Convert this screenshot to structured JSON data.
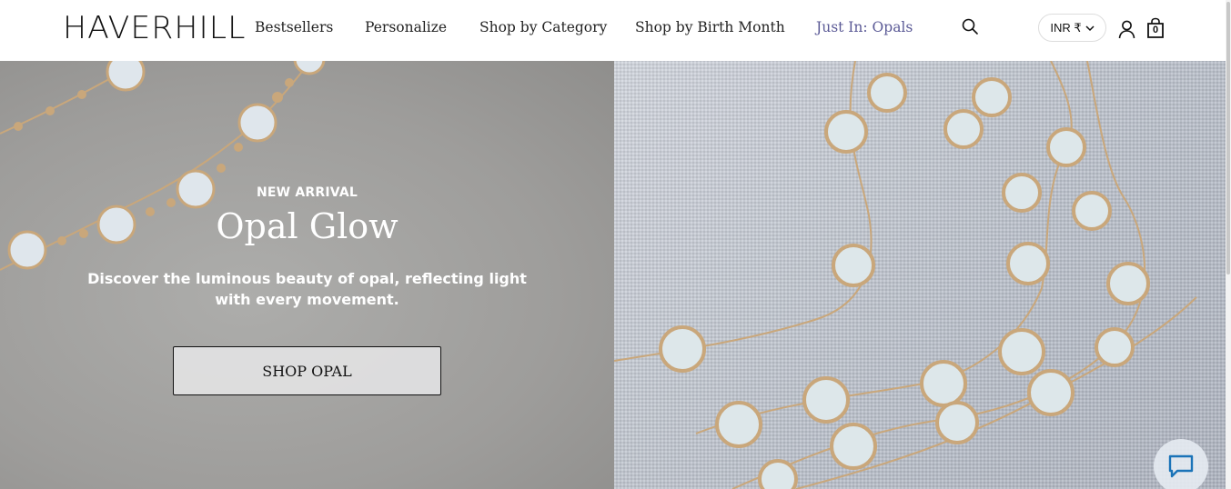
{
  "brand": {
    "logo_text": "HAVERHILL"
  },
  "nav": {
    "items": [
      {
        "label": "Bestsellers"
      },
      {
        "label": "Personalize"
      },
      {
        "label": "Shop by Category"
      },
      {
        "label": "Shop by Birth Month"
      },
      {
        "label": "Just In: Opals"
      }
    ]
  },
  "header": {
    "currency_label": "INR ₹",
    "cart_count": "0",
    "icons": [
      "search-icon",
      "chevron-down-icon",
      "user-icon",
      "shopping-bag-icon"
    ]
  },
  "hero": {
    "eyebrow": "NEW ARRIVAL",
    "title": "Opal Glow",
    "description": "Discover the luminous beauty of opal, reflecting light with every movement.",
    "cta_label": "SHOP OPAL"
  },
  "chat": {
    "icon": "chat-bubble-icon"
  },
  "colors": {
    "highlight_nav": "#5b5a96",
    "hero_text": "#ffffff"
  }
}
